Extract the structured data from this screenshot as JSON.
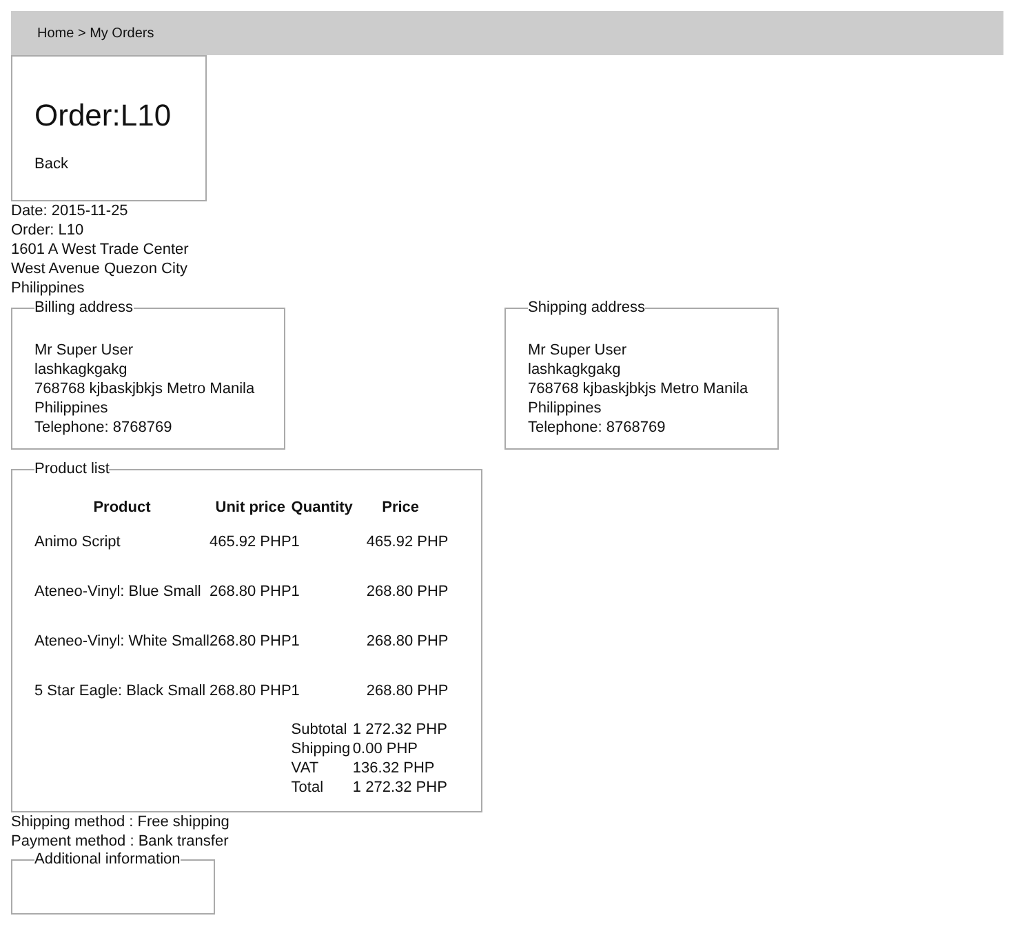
{
  "breadcrumb": "Home > My Orders",
  "header": {
    "title": "Order:L10",
    "back": "Back"
  },
  "info_lines": [
    "Date: 2015-11-25",
    "Order: L10",
    "1601 A West Trade Center",
    "West Avenue Quezon City",
    "Philippines"
  ],
  "addresses": [
    {
      "legend": "Billing address",
      "lines": [
        "Mr Super User",
        "lashkagkgakg",
        "768768 kjbaskjbkjs Metro Manila",
        "Philippines",
        "Telephone: 8768769"
      ]
    },
    {
      "legend": "Shipping address",
      "lines": [
        "Mr Super User",
        "lashkagkgakg",
        "768768 kjbaskjbkjs Metro Manila",
        "Philippines",
        "Telephone: 8768769"
      ]
    }
  ],
  "product_list": {
    "legend": "Product list",
    "columns": [
      "Product",
      "Unit price",
      "Quantity",
      "Price"
    ],
    "rows": [
      [
        "Animo Script",
        "465.92 PHP",
        "1",
        "465.92 PHP"
      ],
      [
        "Ateneo-Vinyl: Blue Small",
        "268.80 PHP",
        "1",
        "268.80 PHP"
      ],
      [
        "Ateneo-Vinyl: White Small",
        "268.80 PHP",
        "1",
        "268.80 PHP"
      ],
      [
        "5 Star Eagle: Black Small",
        "268.80 PHP",
        "1",
        "268.80 PHP"
      ]
    ],
    "totals": [
      [
        "Subtotal",
        "1 272.32 PHP"
      ],
      [
        "Shipping",
        "0.00 PHP"
      ],
      [
        "VAT",
        "136.32 PHP"
      ],
      [
        "Total",
        "1 272.32 PHP"
      ]
    ]
  },
  "methods": [
    "Shipping method : Free shipping",
    "Payment method : Bank transfer"
  ],
  "additional": {
    "legend": "Additional information"
  }
}
